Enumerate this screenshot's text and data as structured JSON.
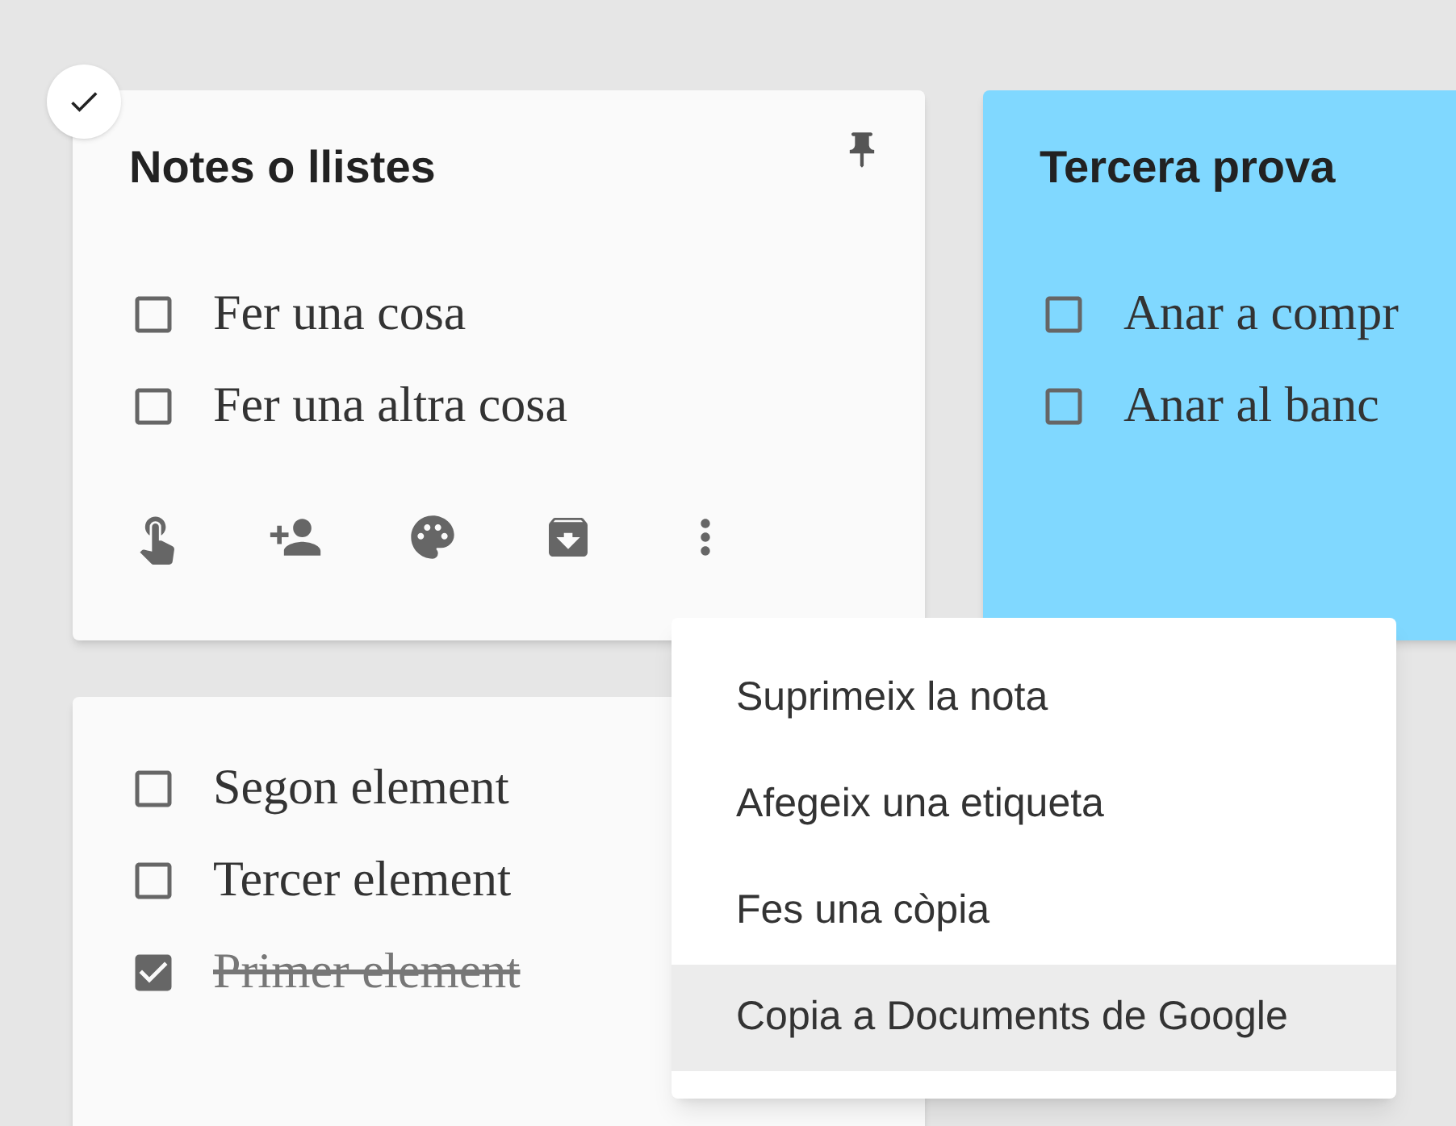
{
  "notes": [
    {
      "title": "Notes o llistes",
      "selected": true,
      "pinned": true,
      "color": "#fafafa",
      "show_toolbar": true,
      "items": [
        {
          "text": "Fer una cosa",
          "checked": false
        },
        {
          "text": "Fer una altra cosa",
          "checked": false
        }
      ]
    },
    {
      "title": "Tercera prova",
      "selected": false,
      "pinned": false,
      "color": "#80d8ff",
      "show_toolbar": false,
      "items": [
        {
          "text": "Anar a compr",
          "checked": false
        },
        {
          "text": "Anar al banc",
          "checked": false
        }
      ]
    },
    {
      "selected": false,
      "pinned": false,
      "color": "#fafafa",
      "show_toolbar": false,
      "items": [
        {
          "text": "Segon element",
          "checked": false
        },
        {
          "text": "Tercer element",
          "checked": false
        },
        {
          "text": "Primer element",
          "checked": true
        }
      ]
    }
  ],
  "menu": [
    {
      "label": "Suprimeix la nota",
      "selected": false
    },
    {
      "label": "Afegeix una etiqueta",
      "selected": false
    },
    {
      "label": "Fes una còpia",
      "selected": false
    },
    {
      "label": "Copia a Documents de Google",
      "selected": true
    }
  ]
}
